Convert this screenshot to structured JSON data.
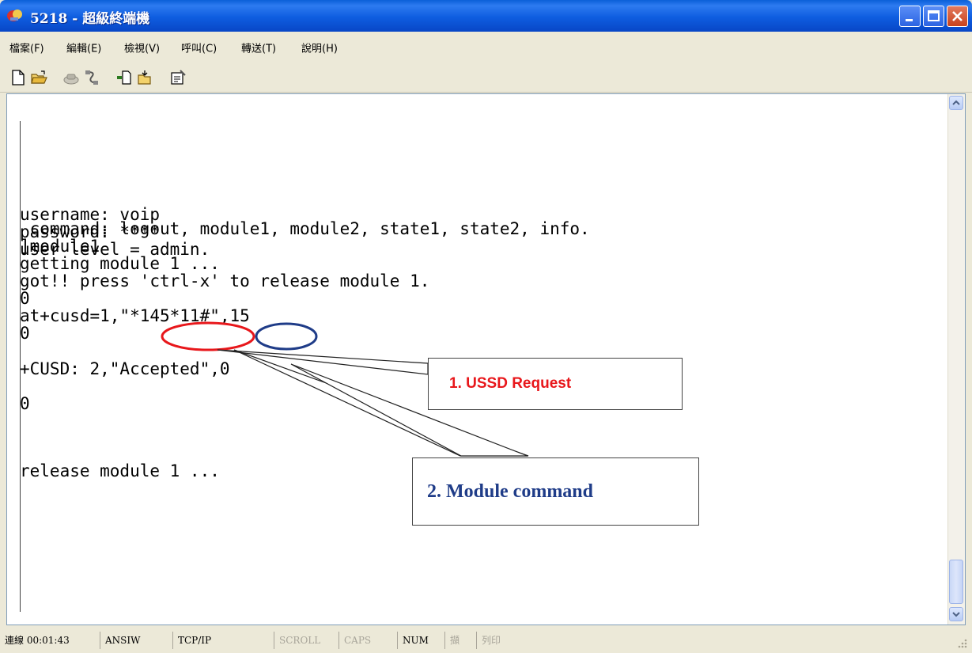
{
  "window": {
    "title": "5218 - 超級終端機"
  },
  "menu": [
    "檔案(F)",
    "編輯(E)",
    "檢視(V)",
    "呼叫(C)",
    "轉送(T)",
    "說明(H)"
  ],
  "toolbar": {
    "icons": [
      "new-file-icon",
      "open-folder-icon",
      "call-icon",
      "disconnect-icon",
      "send-file-icon",
      "receive-file-icon",
      "properties-icon"
    ]
  },
  "terminal": {
    "lines": [
      "username: voip",
      "password: ****",
      "user level = admin.",
      "",
      " command: logout, module1, module2, state1, state2, info.",
      "]module1",
      "getting module 1 ...",
      "got!! press 'ctrl-x' to release module 1.",
      "0",
      "at+cusd=1,\"*145*11#\",15",
      "0",
      "",
      "+CUSD: 2,\"Accepted\",0",
      "",
      "0",
      "",
      "release module 1 ..."
    ]
  },
  "annotations": {
    "ussd_request": {
      "label": "1. USSD Request",
      "color": "#E8171B"
    },
    "module_command": {
      "label": "2. Module command",
      "color": "#1F3C88"
    }
  },
  "status": {
    "connection_time": "連線 00:01:43",
    "emulation": "ANSIW",
    "protocol": "TCP/IP",
    "scroll": "SCROLL",
    "caps": "CAPS",
    "num": "NUM",
    "capture": "擷",
    "print": "列印"
  }
}
